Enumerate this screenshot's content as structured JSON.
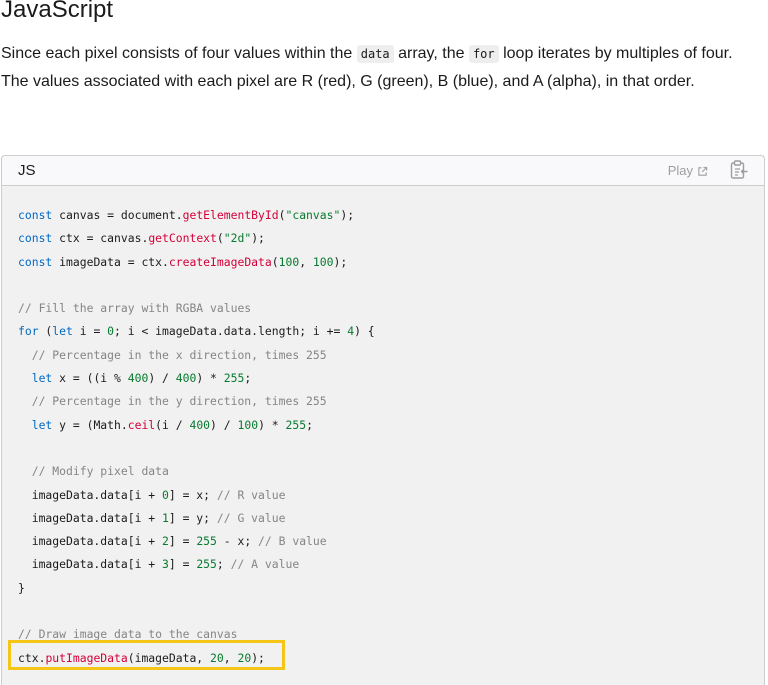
{
  "heading": "JavaScript",
  "intro": {
    "part1": "Since each pixel consists of four values within the ",
    "code1": "data",
    "part2": " array, the ",
    "code2": "for",
    "part3": " loop iterates by multiples of four. The values associated with each pixel are R (red), G (green), B (blue), and A (alpha), in that order."
  },
  "code_box": {
    "language": "JS",
    "play_label": "Play",
    "play_icon": "external-link-icon",
    "copy_icon": "clipboard-copy-icon",
    "highlight_color": "#f5c518"
  },
  "code_lines": [
    [
      [
        "kw",
        "const"
      ],
      [
        "op",
        " canvas = document."
      ],
      [
        "fn",
        "getElementById"
      ],
      [
        "op",
        "("
      ],
      [
        "str",
        "\"canvas\""
      ],
      [
        "op",
        ");"
      ]
    ],
    [
      [
        "kw",
        "const"
      ],
      [
        "op",
        " ctx = canvas."
      ],
      [
        "fn",
        "getContext"
      ],
      [
        "op",
        "("
      ],
      [
        "str",
        "\"2d\""
      ],
      [
        "op",
        ");"
      ]
    ],
    [
      [
        "kw",
        "const"
      ],
      [
        "op",
        " imageData = ctx."
      ],
      [
        "fn",
        "createImageData"
      ],
      [
        "op",
        "("
      ],
      [
        "num",
        "100"
      ],
      [
        "op",
        ", "
      ],
      [
        "num",
        "100"
      ],
      [
        "op",
        ");"
      ]
    ],
    [],
    [
      [
        "cmt",
        "// Fill the array with RGBA values"
      ]
    ],
    [
      [
        "kw",
        "for"
      ],
      [
        "op",
        " ("
      ],
      [
        "kw",
        "let"
      ],
      [
        "op",
        " i = "
      ],
      [
        "num",
        "0"
      ],
      [
        "op",
        "; i < imageData.data.length; i += "
      ],
      [
        "num",
        "4"
      ],
      [
        "op",
        ") {"
      ]
    ],
    [
      [
        "op",
        "  "
      ],
      [
        "cmt",
        "// Percentage in the x direction, times 255"
      ]
    ],
    [
      [
        "op",
        "  "
      ],
      [
        "kw",
        "let"
      ],
      [
        "op",
        " x = ((i % "
      ],
      [
        "num",
        "400"
      ],
      [
        "op",
        ") / "
      ],
      [
        "num",
        "400"
      ],
      [
        "op",
        ") * "
      ],
      [
        "num",
        "255"
      ],
      [
        "op",
        ";"
      ]
    ],
    [
      [
        "op",
        "  "
      ],
      [
        "cmt",
        "// Percentage in the y direction, times 255"
      ]
    ],
    [
      [
        "op",
        "  "
      ],
      [
        "kw",
        "let"
      ],
      [
        "op",
        " y = (Math."
      ],
      [
        "fn",
        "ceil"
      ],
      [
        "op",
        "(i / "
      ],
      [
        "num",
        "400"
      ],
      [
        "op",
        ") / "
      ],
      [
        "num",
        "100"
      ],
      [
        "op",
        ") * "
      ],
      [
        "num",
        "255"
      ],
      [
        "op",
        ";"
      ]
    ],
    [],
    [
      [
        "op",
        "  "
      ],
      [
        "cmt",
        "// Modify pixel data"
      ]
    ],
    [
      [
        "op",
        "  imageData.data[i + "
      ],
      [
        "num",
        "0"
      ],
      [
        "op",
        "] = x; "
      ],
      [
        "cmt",
        "// R value"
      ]
    ],
    [
      [
        "op",
        "  imageData.data[i + "
      ],
      [
        "num",
        "1"
      ],
      [
        "op",
        "] = y; "
      ],
      [
        "cmt",
        "// G value"
      ]
    ],
    [
      [
        "op",
        "  imageData.data[i + "
      ],
      [
        "num",
        "2"
      ],
      [
        "op",
        "] = "
      ],
      [
        "num",
        "255"
      ],
      [
        "op",
        " - x; "
      ],
      [
        "cmt",
        "// B value"
      ]
    ],
    [
      [
        "op",
        "  imageData.data[i + "
      ],
      [
        "num",
        "3"
      ],
      [
        "op",
        "] = "
      ],
      [
        "num",
        "255"
      ],
      [
        "op",
        "; "
      ],
      [
        "cmt",
        "// A value"
      ]
    ],
    [
      [
        "op",
        "}"
      ]
    ],
    [],
    [
      [
        "cmt",
        "// Draw image data to the canvas"
      ]
    ],
    [
      [
        "op",
        "ctx."
      ],
      [
        "fn",
        "putImageData"
      ],
      [
        "op",
        "(imageData, "
      ],
      [
        "num",
        "20"
      ],
      [
        "op",
        ", "
      ],
      [
        "num",
        "20"
      ],
      [
        "op",
        ");"
      ]
    ]
  ]
}
